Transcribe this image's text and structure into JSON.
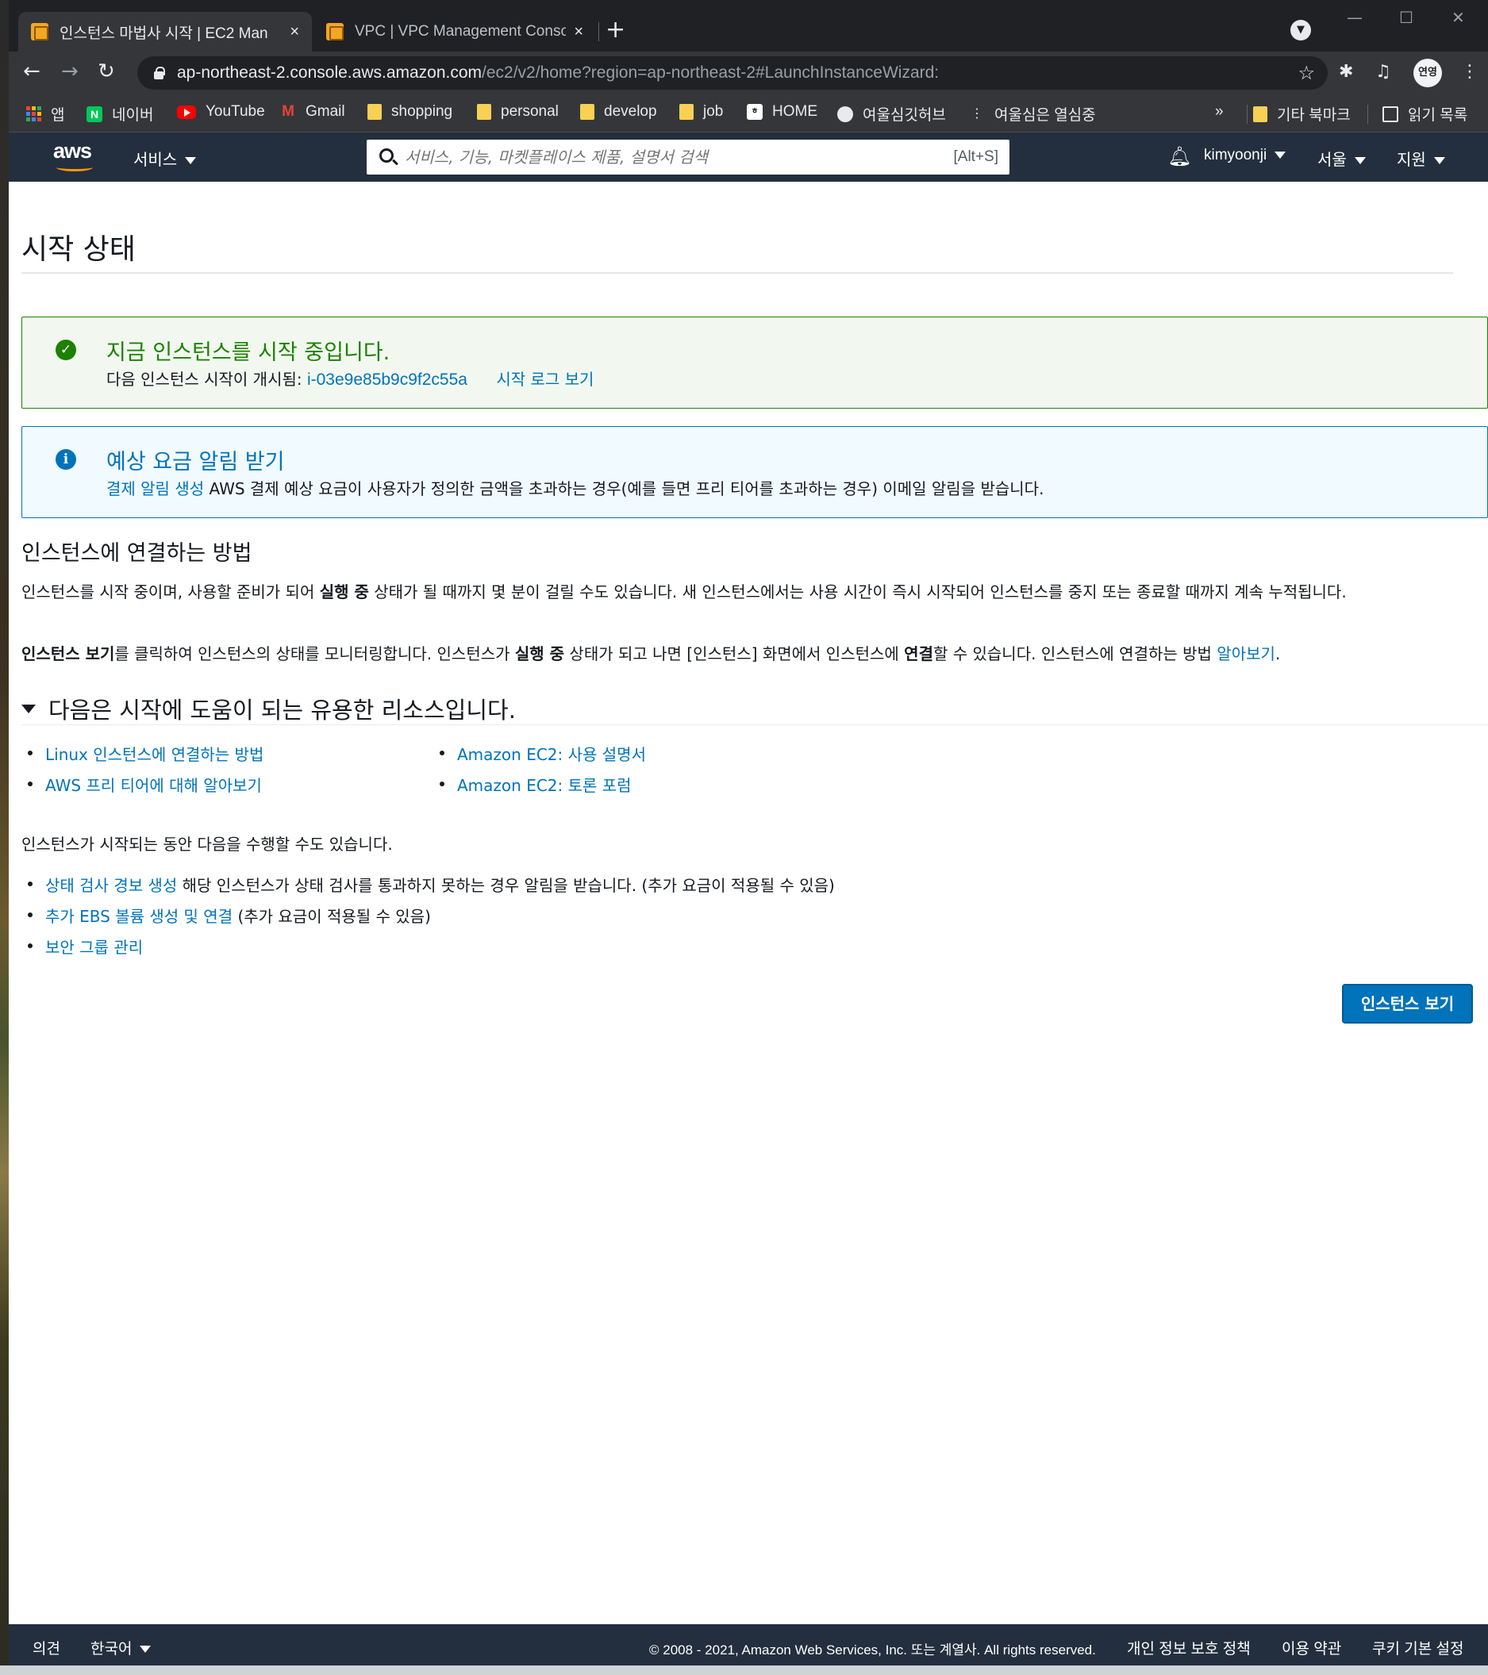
{
  "browser": {
    "tabs": [
      {
        "title": "인스턴스 마법사 시작 | EC2 Man",
        "active": true
      },
      {
        "title": "VPC | VPC Management Consol",
        "active": false
      }
    ],
    "new_tab": "+",
    "url": {
      "host": "ap-northeast-2.console.aws.amazon.com",
      "path": "/ec2/v2/home?region=ap-northeast-2#LaunchInstanceWizard:"
    },
    "profile_label": "연영",
    "bookmarks": [
      {
        "label": "앱",
        "icon": "apps-icon"
      },
      {
        "label": "네이버",
        "icon": "naver-icon"
      },
      {
        "label": "YouTube",
        "icon": "youtube-icon"
      },
      {
        "label": "Gmail",
        "icon": "gmail-icon"
      },
      {
        "label": "shopping",
        "icon": "folder-icon"
      },
      {
        "label": "personal",
        "icon": "folder-icon"
      },
      {
        "label": "develop",
        "icon": "folder-icon"
      },
      {
        "label": "job",
        "icon": "folder-icon"
      },
      {
        "label": "HOME",
        "icon": "home-icon"
      },
      {
        "label": "여울심깃허브",
        "icon": "github-icon"
      },
      {
        "label": "여울심은 열심중",
        "icon": "tree-icon"
      }
    ],
    "bookmarks_overflow": "»",
    "other_bookmarks": "기타 북마크",
    "reading_list": "읽기 목록"
  },
  "aws_header": {
    "logo": "aws",
    "services": "서비스",
    "search_placeholder": "서비스, 기능, 마켓플레이스 제품, 설명서 검색",
    "search_shortcut": "[Alt+S]",
    "user": "kimyoonji",
    "region": "서울",
    "support": "지원"
  },
  "page": {
    "title": "시작 상태",
    "success_alert": {
      "heading": "지금 인스턴스를 시작 중입니다.",
      "body_prefix": "다음 인스턴스 시작이 개시됨: ",
      "instance_id": "i-03e9e85b9c9f2c55a",
      "log_link": "시작 로그 보기"
    },
    "info_alert": {
      "heading": "예상 요금 알림 받기",
      "link": "결제 알림 생성",
      "body": " AWS 결제 예상 요금이 사용자가 정의한 금액을 초과하는 경우(예를 들면 프리 티어를 초과하는 경우) 이메일 알림을 받습니다."
    },
    "connect_section": {
      "title": "인스턴스에 연결하는 방법",
      "p1_a": "인스턴스를 시작 중이며, 사용할 준비가 되어 ",
      "p1_b": "실행 중",
      "p1_c": " 상태가 될 때까지 몇 분이 걸릴 수도 있습니다. 새 인스턴스에서는 사용 시간이 즉시 시작되어 인스턴스를 중지 또는 종료할 때까지 계속 누적됩니다.",
      "p2_a": "인스턴스 보기",
      "p2_b": "를 클릭하여 인스턴스의 상태를 모니터링합니다. 인스턴스가 ",
      "p2_c": "실행 중",
      "p2_d": " 상태가 되고 나면 [인스턴스] 화면에서 인스턴스에 ",
      "p2_e": "연결",
      "p2_f": "할 수 있습니다. 인스턴스에 연결하는 방법 ",
      "p2_link": "알아보기",
      "p2_end": "."
    },
    "resources": {
      "title": "다음은 시작에 도움이 되는 유용한 리소스입니다.",
      "left_links": [
        "Linux 인스턴스에 연결하는 방법",
        "AWS 프리 티어에 대해 알아보기"
      ],
      "right_links": [
        "Amazon EC2: 사용 설명서",
        "Amazon EC2: 토론 포럼"
      ]
    },
    "while_launching": {
      "title": "인스턴스가 시작되는 동안 다음을 수행할 수도 있습니다.",
      "items": [
        {
          "link": "상태 검사 경보 생성",
          "text": " 해당 인스턴스가 상태 검사를 통과하지 못하는 경우 알림을 받습니다. (추가 요금이 적용될 수 있음)"
        },
        {
          "link": "추가 EBS 볼륨 생성 및 연결",
          "text": " (추가 요금이 적용될 수 있음)"
        },
        {
          "link": "보안 그룹 관리",
          "text": ""
        }
      ]
    },
    "view_instances_button": "인스턴스 보기"
  },
  "footer": {
    "feedback": "의견",
    "language": "한국어",
    "copyright": "© 2008 - 2021, Amazon Web Services, Inc. 또는 계열사. All rights reserved.",
    "privacy": "개인 정보 보호 정책",
    "terms": "이용 약관",
    "cookies": "쿠키 기본 설정"
  },
  "colors": {
    "aws_nav": "#232f3e",
    "link": "#0073bb",
    "success": "#1d8102",
    "accent": "#ff9900"
  }
}
